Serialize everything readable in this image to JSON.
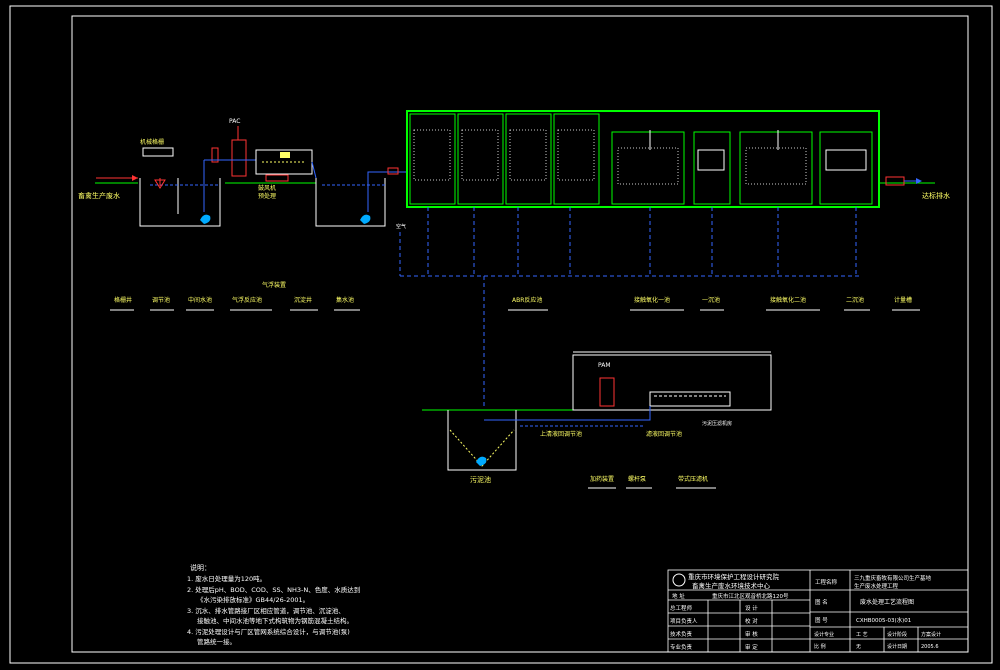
{
  "labels": {
    "pac": "PAC",
    "pam": "PAM",
    "inlet": "畜禽生产废水",
    "outlet": "达标排水",
    "screen_top": "机械格栅",
    "pretreat": "预处理",
    "blower": "鼓风机",
    "legend_title": "气浮装置",
    "air": "空气"
  },
  "process_row1": [
    "格栅井",
    "调节池",
    "中间水池",
    "气浮反应池",
    "沉淀井",
    "集水池"
  ],
  "process_row2": [
    "ABR反应池",
    "接触氧化一池",
    "一沉池",
    "接触氧化二池",
    "二沉池",
    "计量槽"
  ],
  "sludge_labels": {
    "sludge_tank": "污泥池",
    "supernatant": "上清液回调节池",
    "filtrate": "滤液回调节池",
    "filter_press_room": "污泥压滤机房",
    "row": [
      "加药装置",
      "螺杆泵",
      "带式压滤机"
    ]
  },
  "notes": {
    "title": "说明：",
    "lines": [
      "1. 废水日处理量为120吨。",
      "2. 处理后pH、BOD、COD、SS、NH3-N、色度、水质达到",
      "《水污染排放标准》GB44/26-2001。",
      "3. 沉水、排水管路接厂区相应管道，调节池、沉淀池、",
      "接触池、中间水池等地下式构筑物为钢筋混凝土结构。",
      "4. 污泥处理设计与厂区管网系统综合设计，与调节池(泵)",
      "管路统一接。"
    ]
  },
  "title_block": {
    "company_line1": "重庆市环境保护工程设计研究院",
    "company_line2": "畜禽生产废水环境技术中心",
    "project_label": "工程名称",
    "project_value": "三九重庆畜牧有限公司生产基地",
    "project_value2": "生产废水处理工程",
    "address_label": "地  址",
    "address_value": "重庆市江北区观音桥北路120号",
    "drawing_label": "图  名",
    "drawing_value": "废水处理工艺流程图",
    "number_label": "图  号",
    "number_value": "CXHB0005-03(水)01",
    "rows": [
      [
        "总工程师",
        "",
        "设  计",
        ""
      ],
      [
        "项目负责人",
        "",
        "校  对",
        ""
      ],
      [
        "技术负责",
        "",
        "审  核",
        ""
      ],
      [
        "专业负责",
        "",
        "审  定",
        ""
      ]
    ],
    "right_rows": [
      [
        "设计专业",
        "工  艺",
        "设计阶段",
        "方案设计"
      ],
      [
        "比  例",
        "无",
        "设计日期",
        "2005.6"
      ]
    ]
  }
}
